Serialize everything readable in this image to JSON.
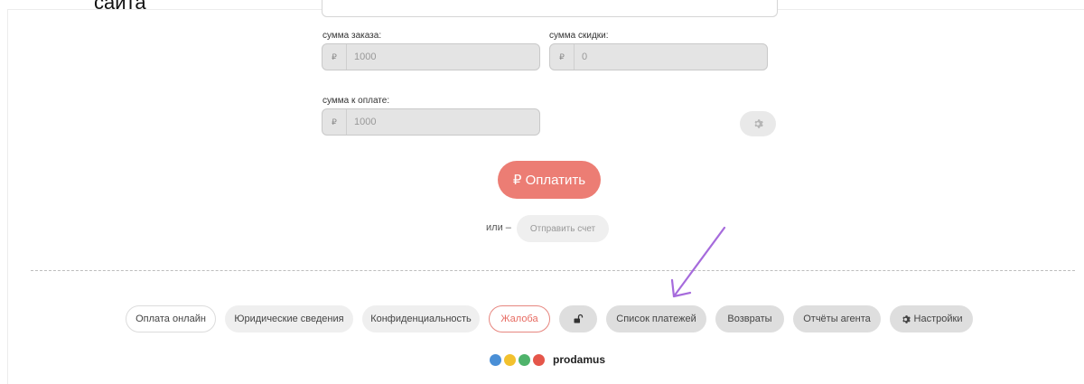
{
  "caption": "сайта",
  "form": {
    "order_sum_label": "сумма заказа:",
    "discount_label": "сумма скидки:",
    "to_pay_label": "сумма к оплате:",
    "currency_symbol": "₽",
    "order_sum_value": "1000",
    "discount_value": "0",
    "to_pay_value": "1000"
  },
  "pay_button": "₽ Оплатить",
  "or_text": "или –",
  "send_invoice_button": "Отправить счет",
  "footer": {
    "online_payment": "Оплата онлайн",
    "legal_info": "Юридические сведения",
    "privacy": "Конфиденциальность",
    "complaint": "Жалоба",
    "payments_list": "Список платежей",
    "refunds": "Возвраты",
    "agent_reports": "Отчёты агента",
    "settings": "Настройки"
  },
  "brand": "prodamus",
  "colors": {
    "pay_accent": "#ec7d74",
    "arrow": "#a66bdc",
    "logo_blue": "#4a8fd6",
    "logo_yellow": "#f2c12e",
    "logo_green": "#4fb36b",
    "logo_red": "#e5564a"
  }
}
